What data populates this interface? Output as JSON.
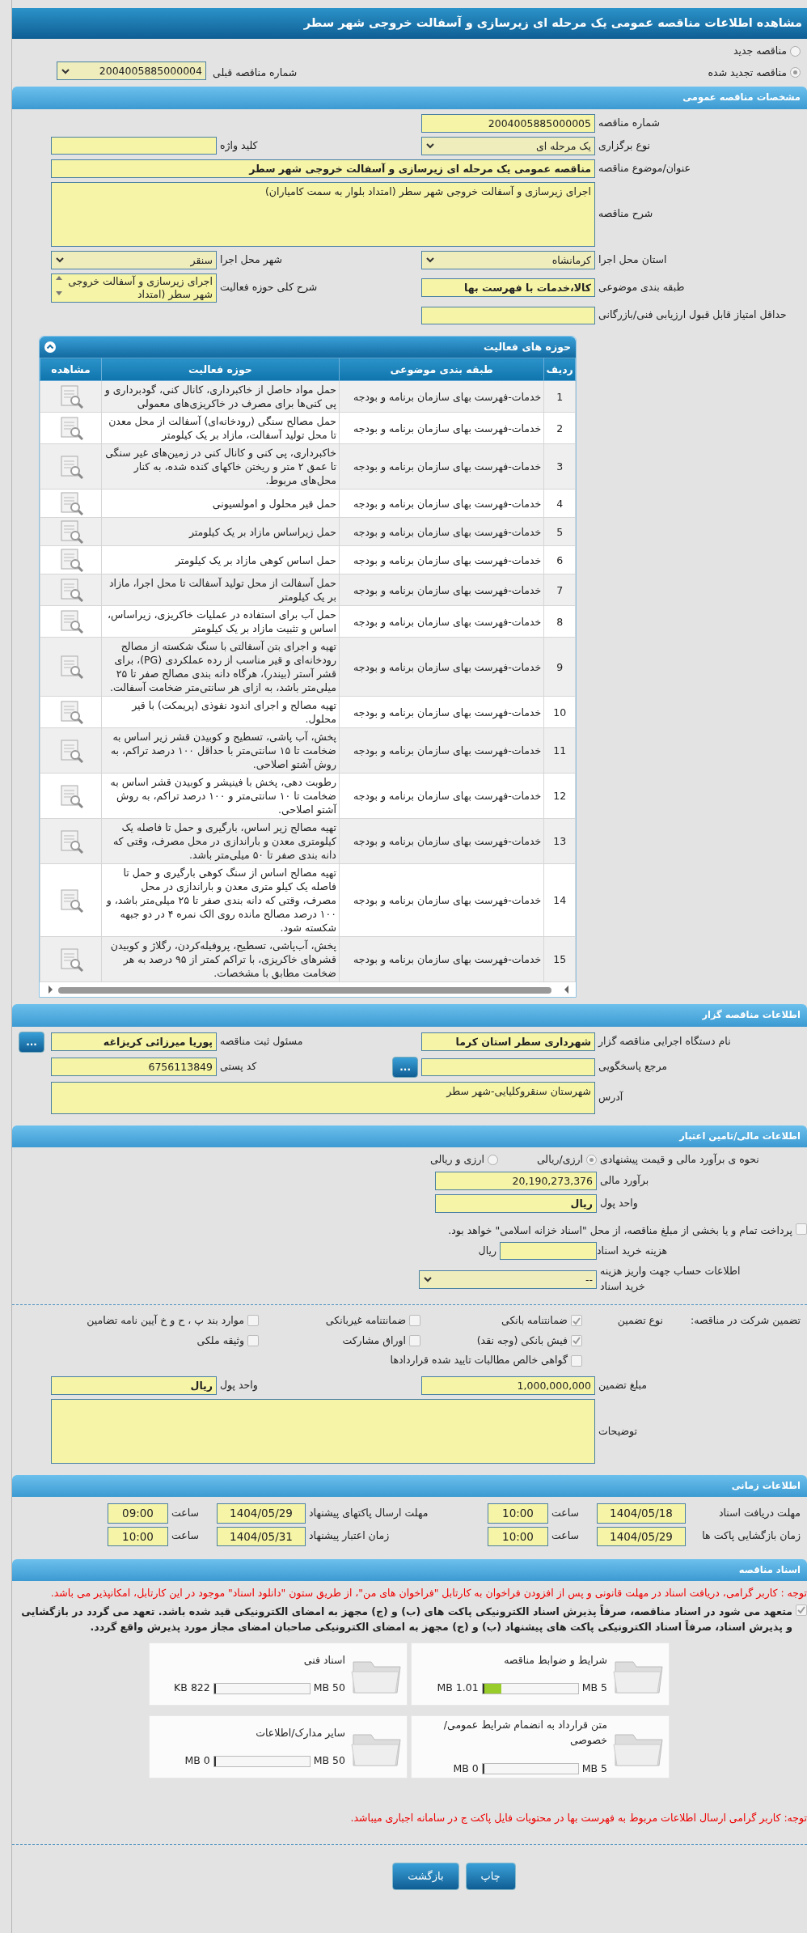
{
  "title": "مشاهده اطلاعات مناقصه عمومی یک مرحله ای زیرسازی و آسفالت خروجی شهر سطر",
  "tender_status": [
    {
      "label": "مناقصه جدید",
      "selected": false
    },
    {
      "label": "مناقصه تجدید شده",
      "selected": true
    }
  ],
  "previous_tender": {
    "label": "شماره مناقصه قبلی",
    "value": "2004005885000004"
  },
  "general": {
    "title": "مشخصات مناقصه عمومی",
    "rows": [
      {
        "right": {
          "kind": "text",
          "label": "شماره مناقصه",
          "value": "2004005885000005"
        }
      },
      {
        "right": {
          "kind": "select",
          "label": "نوع برگزاری",
          "value": "یک مرحله ای"
        },
        "left": {
          "kind": "text",
          "label": "کلید واژه"
        }
      },
      {
        "right": {
          "kind": "wide",
          "label": "عنوان/موضوع مناقصه",
          "value": "مناقصه عمومی یک مرحله ای زیرسازی و آسفالت خروجی شهر سطر",
          "bold": true
        }
      },
      {
        "right": {
          "kind": "textarea",
          "label": "شرح مناقصه",
          "value": "اجرای زیرسازی و آسفالت خروجی شهر سطر (امتداد بلوار به سمت کامیاران)"
        }
      },
      {
        "right": {
          "kind": "select",
          "label": "استان محل اجرا",
          "value": "کرمانشاه"
        },
        "left": {
          "kind": "select",
          "label": "شهر محل اجرا",
          "value": "سنقر"
        }
      },
      {
        "right": {
          "kind": "text",
          "label": "طبقه بندی موضوعی",
          "value": "کالا،خدمات با فهرست بها",
          "bold": true
        },
        "left": {
          "kind": "listbox",
          "label": "شرح کلی حوزه فعالیت",
          "value": "اجرای زیرسازی و آسفالت خروجی شهر سطر (امتداد"
        }
      },
      {
        "right": {
          "kind": "text",
          "label": "حداقل امتیاز قابل قبول ارزیابی فنی/بازرگانی"
        }
      }
    ]
  },
  "activities": {
    "title": "حوزه های فعالیت",
    "columns": [
      "ردیف",
      "طبقه بندی موضوعی",
      "حوزه فعالیت",
      "مشاهده"
    ],
    "rows": [
      {
        "index": "1",
        "category": "خدمات-فهرست بهای سازمان برنامه و بودجه",
        "activity": "حمل مواد حاصل از خاکبرداری، کانال کنی، گودبرداری و پی کنی‌ها برای مصرف در خاکریزی‌های معمولی"
      },
      {
        "index": "2",
        "category": "خدمات-فهرست بهای سازمان برنامه و بودجه",
        "activity": "حمل مصالح سنگی (رودخانه‌ای) آسفالت از محل معدن تا محل تولید آسفالت، مازاد بر یک کیلومتر"
      },
      {
        "index": "3",
        "category": "خدمات-فهرست بهای سازمان برنامه و بودجه",
        "activity": "خاکبرداری، پی کنی و کانال کنی در زمین‌های غیر سنگی تا عمق ۲ متر و ریختن خاکهای کنده شده، به کنار محل‌های مربوط."
      },
      {
        "index": "4",
        "category": "خدمات-فهرست بهای سازمان برنامه و بودجه",
        "activity": "حمل قیر محلول و امولسیونی"
      },
      {
        "index": "5",
        "category": "خدمات-فهرست بهای سازمان برنامه و بودجه",
        "activity": "حمل زیراساس مازاد بر یک کیلومتر"
      },
      {
        "index": "6",
        "category": "خدمات-فهرست بهای سازمان برنامه و بودجه",
        "activity": "حمل اساس کوهی مازاد بر یک کیلومتر"
      },
      {
        "index": "7",
        "category": "خدمات-فهرست بهای سازمان برنامه و بودجه",
        "activity": "حمل آسفالت از محل تولید آسفالت تا محل اجرا، مازاد بر یک کیلومتر"
      },
      {
        "index": "8",
        "category": "خدمات-فهرست بهای سازمان برنامه و بودجه",
        "activity": "حمل آب برای استفاده در عملیات خاکریزی، زیراساس، اساس و تثبیت مازاد بر یک کیلومتر"
      },
      {
        "index": "9",
        "category": "خدمات-فهرست بهای سازمان برنامه و بودجه",
        "activity": "تهیه و اجرای بتن آسفالتی با سنگ شکسته از مصالح رودخانه‌ای و قیر مناسب از رده عملکردی (PG)، برای قشر آستر (بیندر)، هرگاه دانه بندی مصالح صفر تا ۲۵ میلی‌متر باشد، به ازای هر سانتی‌متر ضخامت آسفالت."
      },
      {
        "index": "10",
        "category": "خدمات-فهرست بهای سازمان برنامه و بودجه",
        "activity": "تهیه مصالح و اجرای اندود نفوذی (پریمکت) با قیر محلول."
      },
      {
        "index": "11",
        "category": "خدمات-فهرست بهای سازمان برنامه و بودجه",
        "activity": "پخش، آب پاشی، تسطیح و کوبیدن قشر زیر اساس به ضخامت تا ۱۵ سانتی‌متر با حداقل ۱۰۰ درصد تراکم، به روش آشتو اصلاحی."
      },
      {
        "index": "12",
        "category": "خدمات-فهرست بهای سازمان برنامه و بودجه",
        "activity": "رطوبت دهی، پخش با فینیشر و کوبیدن قشر اساس به ضخامت تا ۱۰ سانتی‌متر و ۱۰۰ درصد تراکم، به روش آشتو اصلاحی."
      },
      {
        "index": "13",
        "category": "خدمات-فهرست بهای سازمان برنامه و بودجه",
        "activity": "تهیه مصالح زیر اساس، بارگیری و حمل تا فاصله یک کیلومتری معدن و باراندازی در محل مصرف، وقتی که دانه بندی صفر تا ۵۰ میلی‌متر باشد."
      },
      {
        "index": "14",
        "category": "خدمات-فهرست بهای سازمان برنامه و بودجه",
        "activity": "تهیه مصالح اساس از سنگ کوهی بارگیری و حمل تا فاصله یک کیلو متری معدن و باراندازی در محل مصرف، وقتی که دانه بندی صفر تا ۲۵ میلی‌متر باشد، و ۱۰۰ درصد مصالح مانده روی الک نمره ۴ در دو جبهه شکسته شود."
      },
      {
        "index": "15",
        "category": "خدمات-فهرست بهای سازمان برنامه و بودجه",
        "activity": "پخش، آب‌پاشی، تسطیح، پروفیله‌کردن، رگلاژ و کوبیدن قشرهای خاکریزی، با تراکم کمتر از ۹۵ درصد به هر ضخامت مطابق با مشخصات."
      }
    ]
  },
  "tenderer": {
    "title": "اطلاعات مناقصه گزار",
    "rows": [
      {
        "right": {
          "kind": "text",
          "label": "نام دستگاه اجرایی مناقصه گزار",
          "value": "شهرداری سطر استان کرما",
          "bold": true
        },
        "left": {
          "kind": "text",
          "label": "مسئول ثبت مناقصه",
          "value": "پوریا میرزائی کریزاغه",
          "bold": true,
          "button": "..."
        }
      },
      {
        "right": {
          "kind": "text",
          "label": "مرجع پاسخگویی",
          "button": "..."
        },
        "left": {
          "kind": "text",
          "label": "کد پستی",
          "value": "6756113849"
        }
      },
      {
        "right": {
          "kind": "memo",
          "label": "آدرس",
          "value": "شهرستان سنقروکلیایی-شهر سطر"
        }
      }
    ]
  },
  "finance": {
    "title": "اطلاعات مالی/تامین اعتبار",
    "pricing": {
      "label": "نحوه ی برآورد مالی و قیمت پیشنهادی",
      "options": [
        {
          "label": "ارزی/ریالی",
          "selected": true
        },
        {
          "label": "ارزی و ریالی",
          "selected": false
        }
      ]
    },
    "estimate": {
      "label": "برآورد مالی",
      "value": "20,190,273,376"
    },
    "currency": {
      "label": "واحد پول",
      "value": "ریال"
    },
    "treasury": {
      "label": "پرداخت تمام و یا بخشی از مبلغ مناقصه، از محل \"اسناد خزانه اسلامی\" خواهد بود.",
      "checked": false
    },
    "doc_fee": {
      "label": "هزینه خرید اسناد",
      "unit": "ریال"
    },
    "account": {
      "label": "اطلاعات حساب جهت واریز هزینه خرید اسناد",
      "value": "--"
    }
  },
  "guarantee": {
    "title": "تضمین شرکت در مناقصه:",
    "type_label": "نوع تضمین",
    "options": [
      {
        "label": "ضمانتنامه بانکی",
        "checked": true
      },
      {
        "label": "ضمانتنامه غیربانکی",
        "checked": false
      },
      {
        "label": "موارد بند پ ، ح و خ آیین نامه تضامین",
        "checked": false
      },
      {
        "label": "فیش بانکی (وجه نقد)",
        "checked": true
      },
      {
        "label": "اوراق مشارکت",
        "checked": false
      },
      {
        "label": "وثیقه ملکی",
        "checked": false
      },
      {
        "label": "گواهی خالص مطالبات تایید شده قراردادها",
        "checked": false
      }
    ],
    "rows": [
      {
        "right": {
          "kind": "text",
          "label": "مبلغ تضمین",
          "value": "1,000,000,000"
        },
        "left": {
          "kind": "text",
          "label": "واحد پول",
          "value": "ریال",
          "bold": true
        }
      },
      {
        "right": {
          "kind": "textarea",
          "label": "توضیحات"
        }
      }
    ]
  },
  "timing": {
    "title": "اطلاعات زمانی",
    "items": [
      {
        "label": "مهلت دریافت اسناد",
        "date": "1404/05/18",
        "time_label": "ساعت",
        "time": "10:00"
      },
      {
        "label": "مهلت ارسال پاکتهای پیشنهاد",
        "date": "1404/05/29",
        "time_label": "ساعت",
        "time": "09:00"
      },
      {
        "label": "زمان بازگشایی پاکت ها",
        "date": "1404/05/29",
        "time_label": "ساعت",
        "time": "10:00"
      },
      {
        "label": "زمان اعتبار پیشنهاد",
        "date": "1404/05/31",
        "time_label": "ساعت",
        "time": "10:00"
      }
    ]
  },
  "documents": {
    "title": "اسناد مناقصه",
    "notice": "توجه : کاربر گرامی، دریافت اسناد در مهلت قانونی و پس از افزودن فراخوان به کارتابل \"فراخوان های من\"، از طریق ستون \"دانلود اسناد\" موجود در این کارتابل، امکانپذیر می باشد.",
    "pledge": {
      "text": "متعهد می شود در اسناد مناقصه، صرفاً پذیرش اسناد الکترونیکی پاکت های (ب) و (ج) مجهز به امضای الکترونیکی قید شده باشد. تعهد می گردد در بازگشایی و پذیرش اسناد، صرفاً اسناد الکترونیکی پاکت های پیشنهاد (ب) و (ج) مجهز به امضای الکترونیکی صاحبان امضای مجاز مورد پذیرش واقع گردد.",
      "checked": true
    },
    "files": [
      {
        "title": "شرایط و ضوابط مناقصه",
        "max": "5 MB",
        "size": "1.01 MB",
        "level": 0.2
      },
      {
        "title": "اسناد فنی",
        "max": "50 MB",
        "size": "822 KB",
        "level": 0.016
      },
      {
        "title": "متن قرارداد به انضمام شرایط عمومی/خصوصی",
        "max": "5 MB",
        "size": "0 MB",
        "level": 0
      },
      {
        "title": "سایر مدارک/اطلاعات",
        "max": "50 MB",
        "size": "0 MB",
        "level": 0
      }
    ],
    "footer_note": "توجه: کاربر گرامی ارسال اطلاعات مربوط به فهرست بها در محتویات فایل پاکت ج در سامانه اجباری میباشد."
  },
  "buttons": [
    "چاپ",
    "بازگشت"
  ]
}
